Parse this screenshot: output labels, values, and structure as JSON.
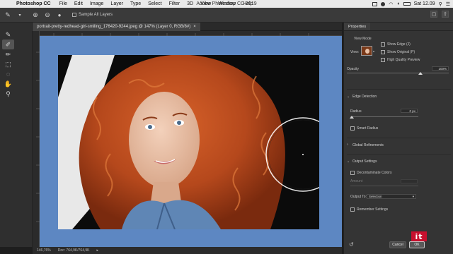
{
  "menubar": {
    "app_name": "Photoshop CC",
    "menus": [
      "File",
      "Edit",
      "Image",
      "Layer",
      "Type",
      "Select",
      "Filter",
      "3D",
      "View",
      "Window",
      "Help"
    ],
    "window_title": "Adobe Photoshop CC 2019",
    "clock": "Sat 12.09"
  },
  "options_bar": {
    "sample_all_layers": "Sample All Layers"
  },
  "document": {
    "tab_label": "portrait-pretty-redhead-girl-smiling_176420-9244.jpeg @ 147% (Layer 0, RGB/8#)",
    "tab_close": "×",
    "zoom": "146,76%",
    "doc_size": "Doc: 764,9K/764,9K"
  },
  "properties": {
    "tab_title": "Properties",
    "view_mode_label": "View Mode",
    "view_label": "View:",
    "show_edge": "Show Edge (J)",
    "show_original": "Show Original (P)",
    "high_quality_preview": "High Quality Preview",
    "opacity_label": "Opacity",
    "opacity_value": "100%",
    "edge_detection_title": "Edge Detection",
    "radius_label": "Radius",
    "radius_value": "0 px",
    "smart_radius": "Smart Radius",
    "global_refinements": "Global Refinements",
    "output_settings_title": "Output Settings",
    "decontaminate_colors": "Decontaminate Colors",
    "amount_label": "Amount",
    "output_to_label": "Output To:",
    "output_to_value": "Selection",
    "remember_settings": "Remember Settings",
    "cancel_label": "Cancel",
    "ok_label": "OK"
  },
  "watermark": "it",
  "colors": {
    "canvas_bg": "#5d87c2",
    "hair": "#b5481c",
    "photo_bg": "#0b0b0b",
    "denim": "#5f86b5"
  }
}
